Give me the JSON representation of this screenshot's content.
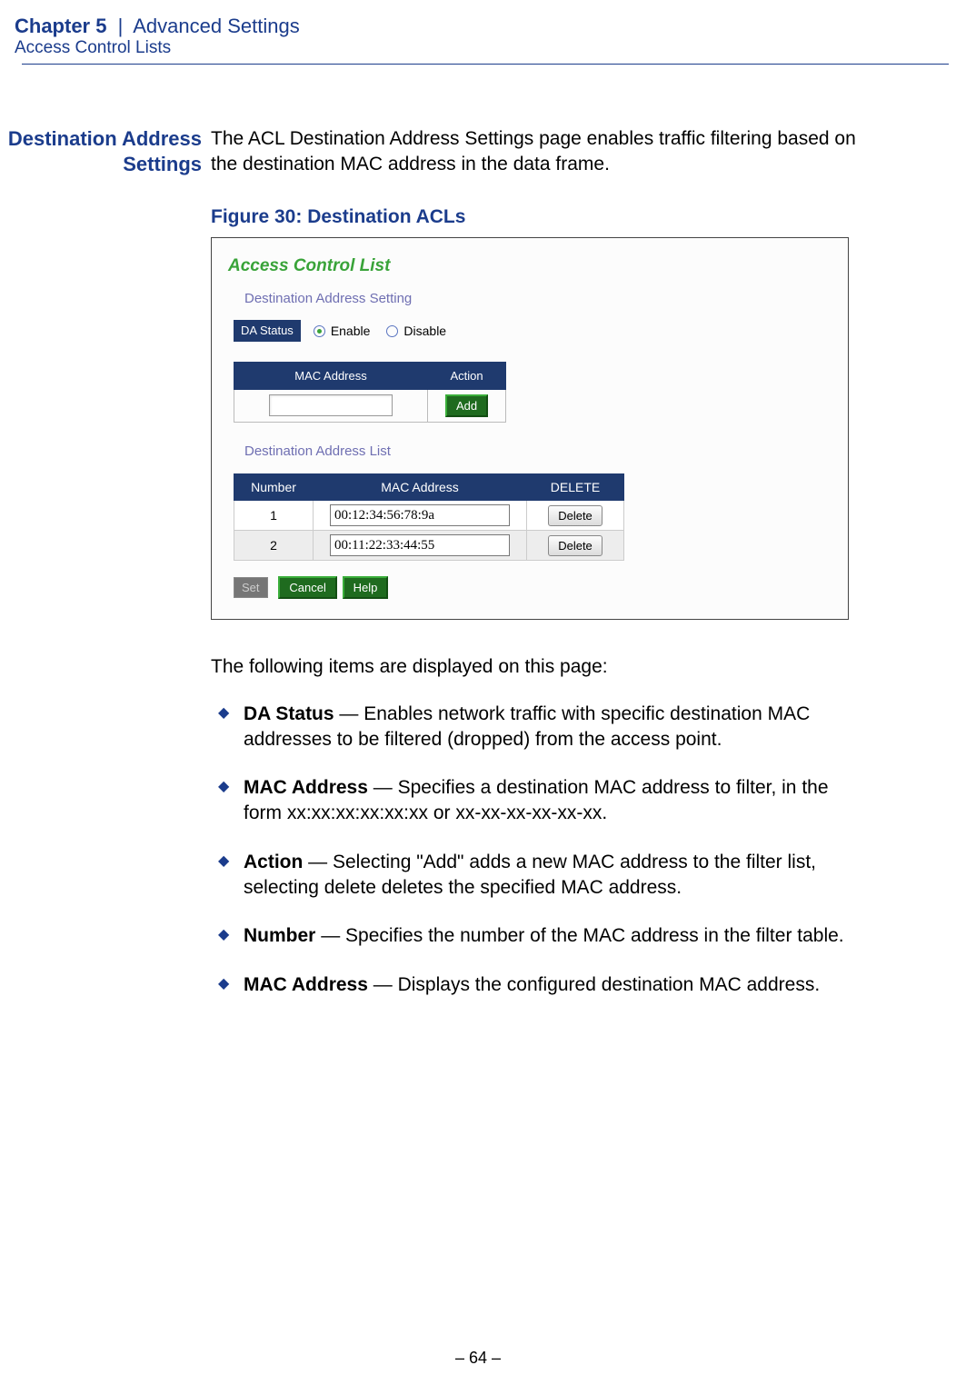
{
  "header": {
    "chapter_label": "Chapter 5",
    "separator": "|",
    "chapter_title": "Advanced Settings",
    "section_title": "Access Control Lists"
  },
  "margin_heading": {
    "line1": "Destination Address",
    "line2": "Settings"
  },
  "intro_paragraph": "The ACL Destination Address Settings page enables traffic filtering based on the destination MAC address in the data frame.",
  "figure": {
    "caption": "Figure 30:  Destination ACLs",
    "panel": {
      "title": "Access Control List",
      "subtitle_setting": "Destination Address Setting",
      "da_status_label": "DA Status",
      "enable_label": "Enable",
      "disable_label": "Disable",
      "da_status_selected": "Enable",
      "add_table": {
        "col_mac": "MAC Address",
        "col_action": "Action",
        "add_button": "Add",
        "input_value": ""
      },
      "subtitle_list": "Destination Address List",
      "list_table": {
        "col_number": "Number",
        "col_mac": "MAC Address",
        "col_delete": "DELETE",
        "delete_button": "Delete",
        "rows": [
          {
            "number": "1",
            "mac": "00:12:34:56:78:9a"
          },
          {
            "number": "2",
            "mac": "00:11:22:33:44:55"
          }
        ]
      },
      "buttons": {
        "set": "Set",
        "cancel": "Cancel",
        "help": "Help"
      }
    }
  },
  "followup_text": "The following items are displayed on this page:",
  "bullets": [
    {
      "term": "DA Status",
      "desc": " — Enables network traffic with specific destination MAC addresses to be filtered (dropped) from the access point."
    },
    {
      "term": "MAC Address",
      "desc": " — Specifies a destination MAC address to filter, in the form xx:xx:xx:xx:xx:xx or xx-xx-xx-xx-xx-xx."
    },
    {
      "term": "Action",
      "desc": " — Selecting \"Add\" adds a new MAC address to the filter list, selecting delete deletes the specified MAC address."
    },
    {
      "term": "Number",
      "desc": " — Specifies the number of the MAC address in the filter table."
    },
    {
      "term": "MAC Address",
      "desc": " — Displays the configured destination MAC address."
    }
  ],
  "footer": {
    "page_number": "–  64  –"
  }
}
